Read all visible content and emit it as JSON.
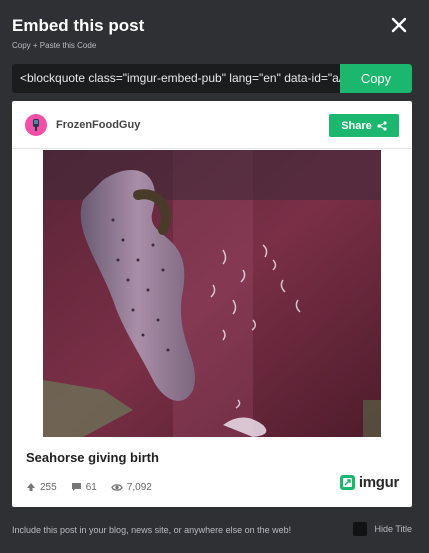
{
  "dialog": {
    "title": "Embed this post",
    "subtitle": "Copy + Paste this Code"
  },
  "embed": {
    "code": "<blockquote class=\"imgur-embed-pub\" lang=\"en\" data-id=\"a/O",
    "copy_label": "Copy"
  },
  "post": {
    "username": "FrozenFoodGuy",
    "share_label": "Share",
    "title": "Seahorse giving birth",
    "upvotes": "255",
    "comments": "61",
    "views": "7,092",
    "brand": "imgur"
  },
  "footer": {
    "text": "Include this post in your blog, news site, or anywhere else on the web!",
    "hide_title_label": "Hide Title"
  },
  "colors": {
    "background": "#2e3033",
    "accent_green": "#1bb76e",
    "avatar_pink": "#f24fa6"
  },
  "icons": [
    "close-icon",
    "share-icon",
    "upvote-icon",
    "comment-icon",
    "eye-icon",
    "imgur-logo-icon",
    "avatar-icon"
  ]
}
